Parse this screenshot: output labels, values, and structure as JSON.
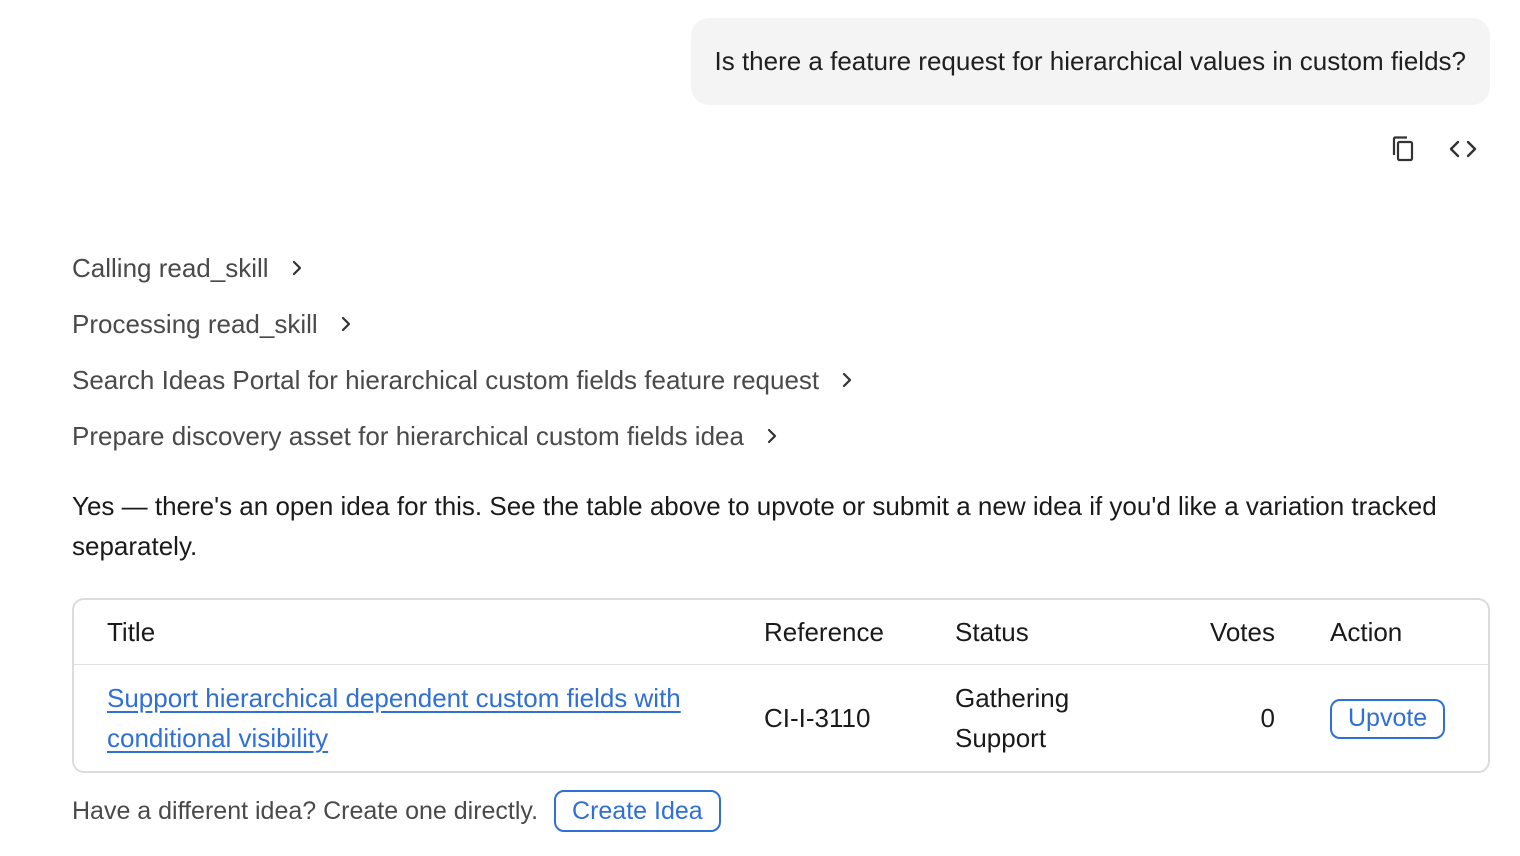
{
  "user_message": {
    "text": "Is there a feature request for hierarchical values in custom fields?"
  },
  "message_actions": [
    {
      "icon": "copy-icon"
    },
    {
      "icon": "code-icon"
    }
  ],
  "steps": [
    {
      "label": "Calling read_skill"
    },
    {
      "label": "Processing read_skill"
    },
    {
      "label": "Search Ideas Portal for hierarchical custom fields feature request"
    },
    {
      "label": "Prepare discovery asset for hierarchical custom fields idea"
    }
  ],
  "answer": {
    "text": "Yes — there's an open idea for this. See the table above to upvote or submit a new idea if you'd like a variation tracked separately."
  },
  "ideas_table": {
    "columns": [
      "Title",
      "Reference",
      "Status",
      "Votes",
      "Action"
    ],
    "rows": [
      {
        "title": "Support hierarchical dependent custom fields with conditional visibility",
        "reference": "CI-I-3110",
        "status": "Gathering Support",
        "votes": "0",
        "action_label": "Upvote"
      }
    ]
  },
  "footer": {
    "prompt": "Have a different idea? Create one directly.",
    "create_label": "Create Idea"
  },
  "colors": {
    "accent": "#2f6fd6",
    "bubble_bg": "#f4f4f4",
    "muted_text": "#4a4a4a"
  }
}
